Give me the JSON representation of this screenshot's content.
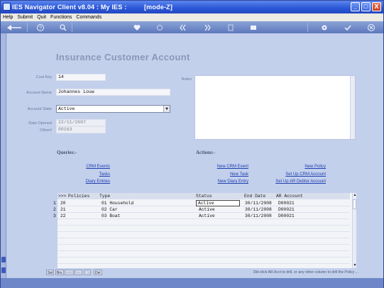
{
  "window": {
    "title": "IES Navigator Client v8.04 : My IES :",
    "mode": "[mode-Z]",
    "minimize": "_",
    "maximize": "□",
    "close": "X"
  },
  "menu": [
    "Help",
    "Submit",
    "Quit",
    "Functions",
    "Commands"
  ],
  "form": {
    "title": "Insurance Customer Account",
    "cust_key_label": "Cust Key",
    "cust_key": "14",
    "account_name_label": "Account Name",
    "account_name": "Johannes Louw",
    "account_state_label": "Account State",
    "account_state": "Active",
    "date_opened_label": "Date Opened",
    "date_opened": "22/11/2007",
    "other_label": "Other#",
    "other_value": "00163",
    "notes_label": "Notes"
  },
  "queries": {
    "heading": "Queries:-",
    "links": [
      "CRM Events",
      "Tasks",
      "Diary Entries"
    ]
  },
  "actions": {
    "heading": "Actions:-",
    "left_links": [
      "New CRM Event",
      "New Task",
      "New Diary Entry"
    ],
    "right_links": [
      "New Policy",
      "Set Up CRM Account",
      "Set Up AR Debtor Account"
    ]
  },
  "grid": {
    "headers": {
      "rownum": ">>>",
      "policies": "Policies",
      "type": "Type",
      "status": "Status",
      "end_date": "End Date",
      "ar_account": "AR Account"
    },
    "rows": [
      {
        "num": "1",
        "policy": "20",
        "type": "01 Household",
        "status": "Active",
        "end_date": "30/11/2008",
        "ar": "D00021"
      },
      {
        "num": "2",
        "policy": "21",
        "type": "02 Car",
        "status": "Active",
        "end_date": "30/11/2008",
        "ar": "D00021"
      },
      {
        "num": "3",
        "policy": "22",
        "type": "03 Boat",
        "status": "Active",
        "end_date": "30/11/2008",
        "ar": "D00021"
      }
    ]
  },
  "status": {
    "nav": [
      "Sel",
      "Brs",
      "Add",
      "Ins",
      "Cir",
      "Del"
    ],
    "hint": "Dbl-click AR Acct to drill, or any other column to drill the Policy ..."
  }
}
